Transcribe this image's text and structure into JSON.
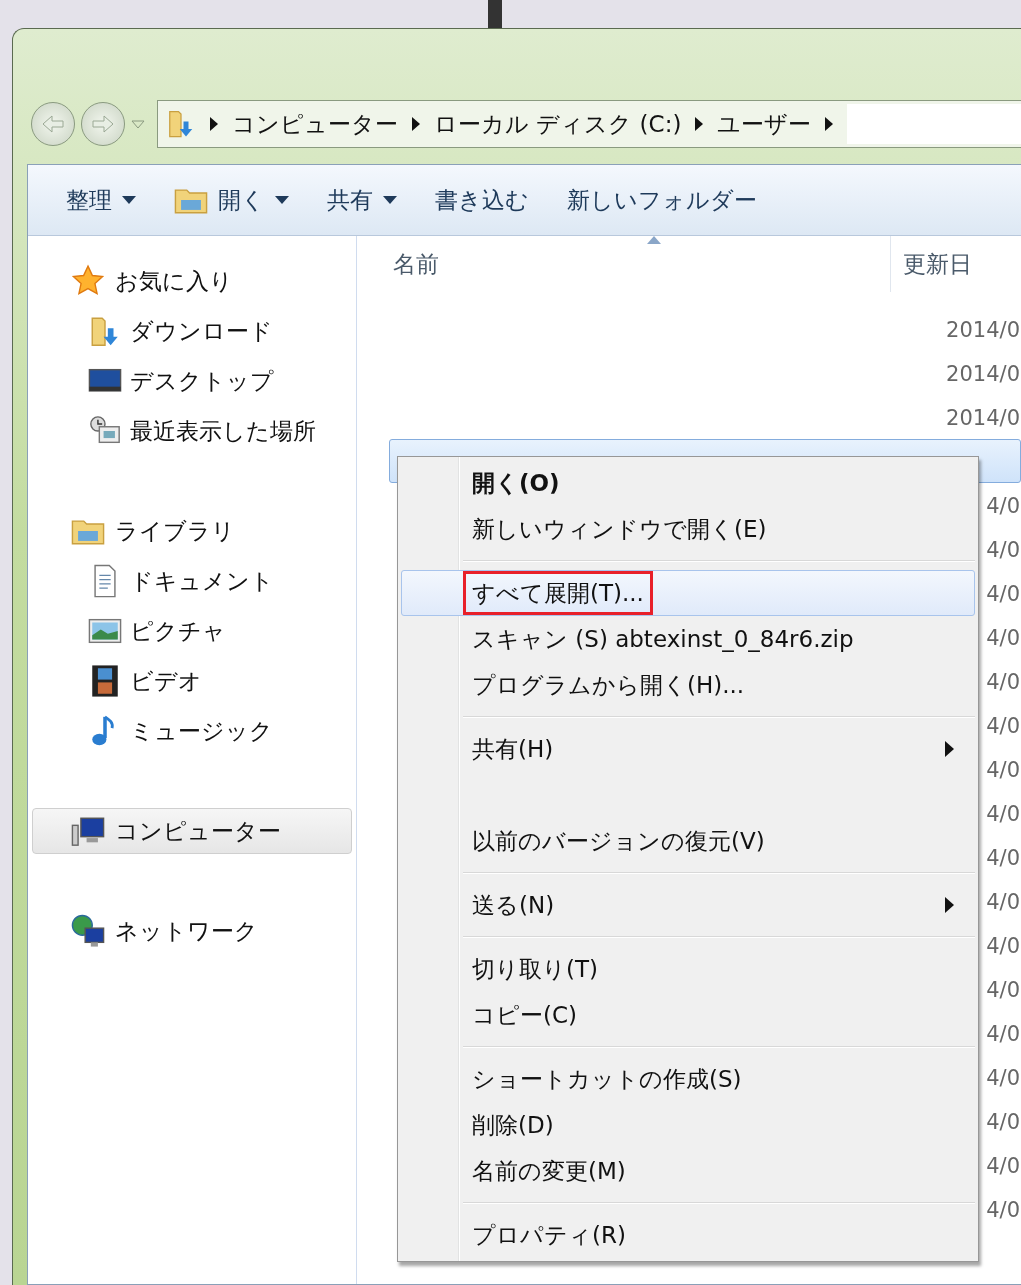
{
  "address_bar": {
    "crumbs": [
      "コンピューター",
      "ローカル ディスク (C:)",
      "ユーザー"
    ]
  },
  "toolbar": {
    "items": [
      {
        "label": "整理",
        "kind": "dropdown"
      },
      {
        "label": "開く",
        "kind": "open"
      },
      {
        "label": "共有",
        "kind": "dropdown"
      },
      {
        "label": "書き込む",
        "kind": "plain"
      },
      {
        "label": "新しいフォルダー",
        "kind": "plain"
      }
    ]
  },
  "sidebar": {
    "groups": [
      {
        "label": "お気に入り",
        "kind": "star",
        "selected": false,
        "children": [
          {
            "label": "ダウンロード",
            "kind": "download"
          },
          {
            "label": "デスクトップ",
            "kind": "desktop"
          },
          {
            "label": "最近表示した場所",
            "kind": "recent"
          }
        ]
      },
      {
        "label": "ライブラリ",
        "kind": "library",
        "selected": false,
        "children": [
          {
            "label": "ドキュメント",
            "kind": "document"
          },
          {
            "label": "ピクチャ",
            "kind": "picture"
          },
          {
            "label": "ビデオ",
            "kind": "video"
          },
          {
            "label": "ミュージック",
            "kind": "music"
          }
        ]
      },
      {
        "label": "コンピューター",
        "kind": "computer",
        "selected": true
      },
      {
        "label": "ネットワーク",
        "kind": "network",
        "selected": false
      }
    ]
  },
  "file_list": {
    "columns": [
      "名前",
      "更新日"
    ],
    "rows": [
      {
        "date": "2014/0",
        "selected": false
      },
      {
        "date": "2014/0",
        "selected": false
      },
      {
        "date": "2014/0",
        "selected": false
      },
      {
        "selected": true
      },
      {
        "date": "4/0",
        "selected": false
      },
      {
        "date": "4/0",
        "selected": false
      },
      {
        "date": "4/0",
        "selected": false
      },
      {
        "date": "4/0",
        "selected": false
      },
      {
        "date": "4/0",
        "selected": false
      },
      {
        "date": "4/0",
        "selected": false
      },
      {
        "date": "4/0",
        "selected": false
      },
      {
        "date": "4/0",
        "selected": false
      },
      {
        "date": "4/0",
        "selected": false
      },
      {
        "date": "4/0",
        "selected": false
      },
      {
        "date": "4/0",
        "selected": false
      },
      {
        "date": "4/0",
        "selected": false
      },
      {
        "date": "4/0",
        "selected": false
      },
      {
        "date": "4/0",
        "selected": false
      },
      {
        "date": "4/0",
        "selected": false
      },
      {
        "date": "4/0",
        "selected": false
      },
      {
        "date": "4/0",
        "selected": false
      }
    ]
  },
  "context_menu": {
    "items": [
      {
        "kind": "item",
        "label": "開く(O)",
        "bold": true,
        "highlighted": false,
        "outlined": false
      },
      {
        "kind": "item",
        "label": "新しいウィンドウで開く(E)",
        "bold": false,
        "highlighted": false,
        "outlined": false
      },
      {
        "kind": "separator"
      },
      {
        "kind": "item",
        "label": "すべて展開(T)...",
        "bold": false,
        "highlighted": true,
        "outlined": true
      },
      {
        "kind": "item",
        "label": "スキャン (S) abtexinst_0_84r6.zip",
        "bold": false,
        "highlighted": false,
        "outlined": false
      },
      {
        "kind": "item",
        "label": "プログラムから開く(H)...",
        "bold": false,
        "highlighted": false,
        "outlined": false
      },
      {
        "kind": "separator"
      },
      {
        "kind": "submenu",
        "label": "共有(H)",
        "bold": false,
        "highlighted": false,
        "outlined": false
      },
      {
        "kind": "blank"
      },
      {
        "kind": "item",
        "label": "以前のバージョンの復元(V)",
        "bold": false,
        "highlighted": false,
        "outlined": false
      },
      {
        "kind": "separator"
      },
      {
        "kind": "submenu",
        "label": "送る(N)",
        "bold": false,
        "highlighted": false,
        "outlined": false
      },
      {
        "kind": "separator"
      },
      {
        "kind": "item",
        "label": "切り取り(T)",
        "bold": false,
        "highlighted": false,
        "outlined": false
      },
      {
        "kind": "item",
        "label": "コピー(C)",
        "bold": false,
        "highlighted": false,
        "outlined": false
      },
      {
        "kind": "separator"
      },
      {
        "kind": "item",
        "label": "ショートカットの作成(S)",
        "bold": false,
        "highlighted": false,
        "outlined": false
      },
      {
        "kind": "item",
        "label": "削除(D)",
        "bold": false,
        "highlighted": false,
        "outlined": false
      },
      {
        "kind": "item",
        "label": "名前の変更(M)",
        "bold": false,
        "highlighted": false,
        "outlined": false
      },
      {
        "kind": "separator"
      },
      {
        "kind": "item",
        "label": "プロパティ(R)",
        "bold": false,
        "highlighted": false,
        "outlined": false
      }
    ]
  }
}
